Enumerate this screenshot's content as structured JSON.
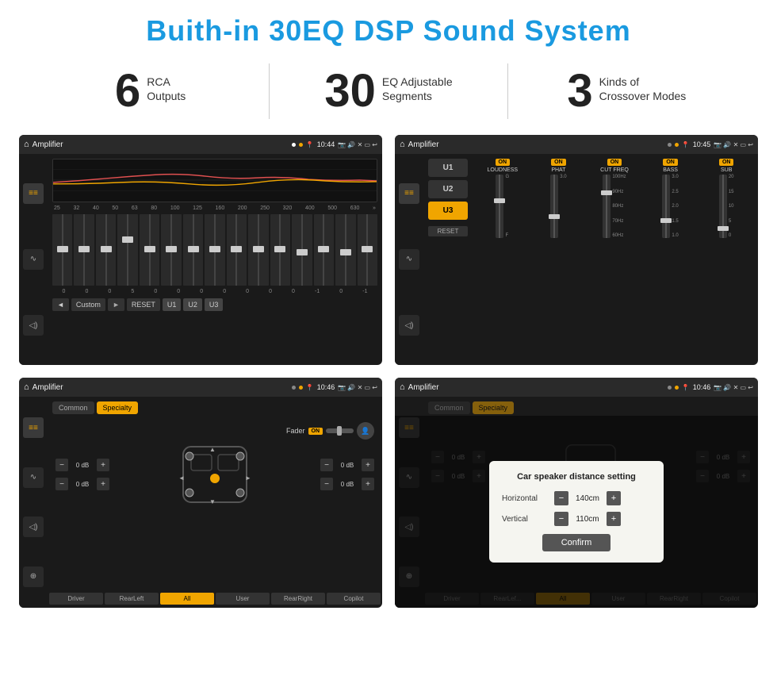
{
  "page": {
    "title": "Buith-in 30EQ DSP Sound System"
  },
  "stats": [
    {
      "number": "6",
      "text_line1": "RCA",
      "text_line2": "Outputs"
    },
    {
      "number": "30",
      "text_line1": "EQ Adjustable",
      "text_line2": "Segments"
    },
    {
      "number": "3",
      "text_line1": "Kinds of",
      "text_line2": "Crossover Modes"
    }
  ],
  "screens": [
    {
      "id": "screen1",
      "topbar": {
        "title": "Amplifier",
        "time": "10:44"
      },
      "eq_labels": [
        "25",
        "32",
        "40",
        "50",
        "63",
        "80",
        "100",
        "125",
        "160",
        "200",
        "250",
        "320",
        "400",
        "500",
        "630"
      ],
      "eq_values": [
        "0",
        "0",
        "0",
        "5",
        "0",
        "0",
        "0",
        "0",
        "0",
        "0",
        "0",
        "-1",
        "0",
        "-1"
      ],
      "controls": [
        "◄",
        "Custom",
        "►",
        "RESET",
        "U1",
        "U2",
        "U3"
      ]
    },
    {
      "id": "screen2",
      "topbar": {
        "title": "Amplifier",
        "time": "10:45"
      },
      "u_buttons": [
        "U1",
        "U2",
        "U3"
      ],
      "channels": [
        {
          "name": "LOUDNESS",
          "on": true
        },
        {
          "name": "PHAT",
          "on": true
        },
        {
          "name": "CUT FREQ",
          "on": true
        },
        {
          "name": "BASS",
          "on": true
        },
        {
          "name": "SUB",
          "on": true
        }
      ],
      "reset_label": "RESET"
    },
    {
      "id": "screen3",
      "topbar": {
        "title": "Amplifier",
        "time": "10:46"
      },
      "tabs": [
        "Common",
        "Specialty"
      ],
      "fader_label": "Fader",
      "fader_on": "ON",
      "vol_rows": [
        {
          "value": "0 dB"
        },
        {
          "value": "0 dB"
        }
      ],
      "vol_rows_right": [
        {
          "value": "0 dB"
        },
        {
          "value": "0 dB"
        }
      ],
      "bottom_btns": [
        "Driver",
        "RearLeft",
        "All",
        "User",
        "RearRight",
        "Copilot"
      ]
    },
    {
      "id": "screen4",
      "topbar": {
        "title": "Amplifier",
        "time": "10:46"
      },
      "tabs": [
        "Common",
        "Specialty"
      ],
      "dialog": {
        "title": "Car speaker distance setting",
        "rows": [
          {
            "label": "Horizontal",
            "value": "140cm"
          },
          {
            "label": "Vertical",
            "value": "110cm"
          }
        ],
        "confirm_label": "Confirm"
      },
      "vol_rows_right": [
        {
          "value": "0 dB"
        },
        {
          "value": "0 dB"
        }
      ],
      "bottom_btns_visible": [
        "Driver",
        "RearLef...",
        "All",
        "User",
        "RearRight",
        "Copilot"
      ]
    }
  ]
}
